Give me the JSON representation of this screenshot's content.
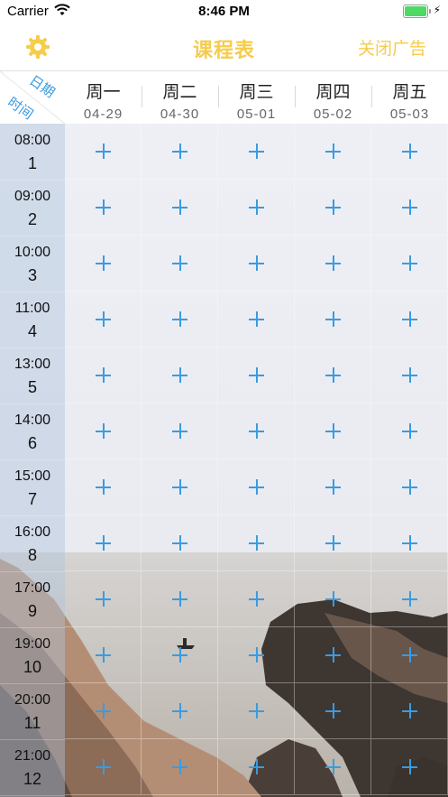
{
  "status": {
    "carrier": "Carrier",
    "time": "8:46 PM"
  },
  "nav": {
    "title": "课程表",
    "right_label": "关闭广告",
    "settings_icon": "gear-icon",
    "accent": "#f6cc4a"
  },
  "corner": {
    "date_label": "日期",
    "time_label": "时间"
  },
  "days": [
    {
      "weekday": "周一",
      "date": "04-29"
    },
    {
      "weekday": "周二",
      "date": "04-30"
    },
    {
      "weekday": "周三",
      "date": "05-01"
    },
    {
      "weekday": "周四",
      "date": "05-02"
    },
    {
      "weekday": "周五",
      "date": "05-03"
    }
  ],
  "periods": [
    {
      "time": "08:00",
      "num": "1"
    },
    {
      "time": "09:00",
      "num": "2"
    },
    {
      "time": "10:00",
      "num": "3"
    },
    {
      "time": "11:00",
      "num": "4"
    },
    {
      "time": "13:00",
      "num": "5"
    },
    {
      "time": "14:00",
      "num": "6"
    },
    {
      "time": "15:00",
      "num": "7"
    },
    {
      "time": "16:00",
      "num": "8"
    },
    {
      "time": "17:00",
      "num": "9"
    },
    {
      "time": "19:00",
      "num": "10"
    },
    {
      "time": "20:00",
      "num": "11"
    },
    {
      "time": "21:00",
      "num": "12"
    }
  ],
  "cell_icon": "plus-icon",
  "plus_color": "#3a9be0"
}
